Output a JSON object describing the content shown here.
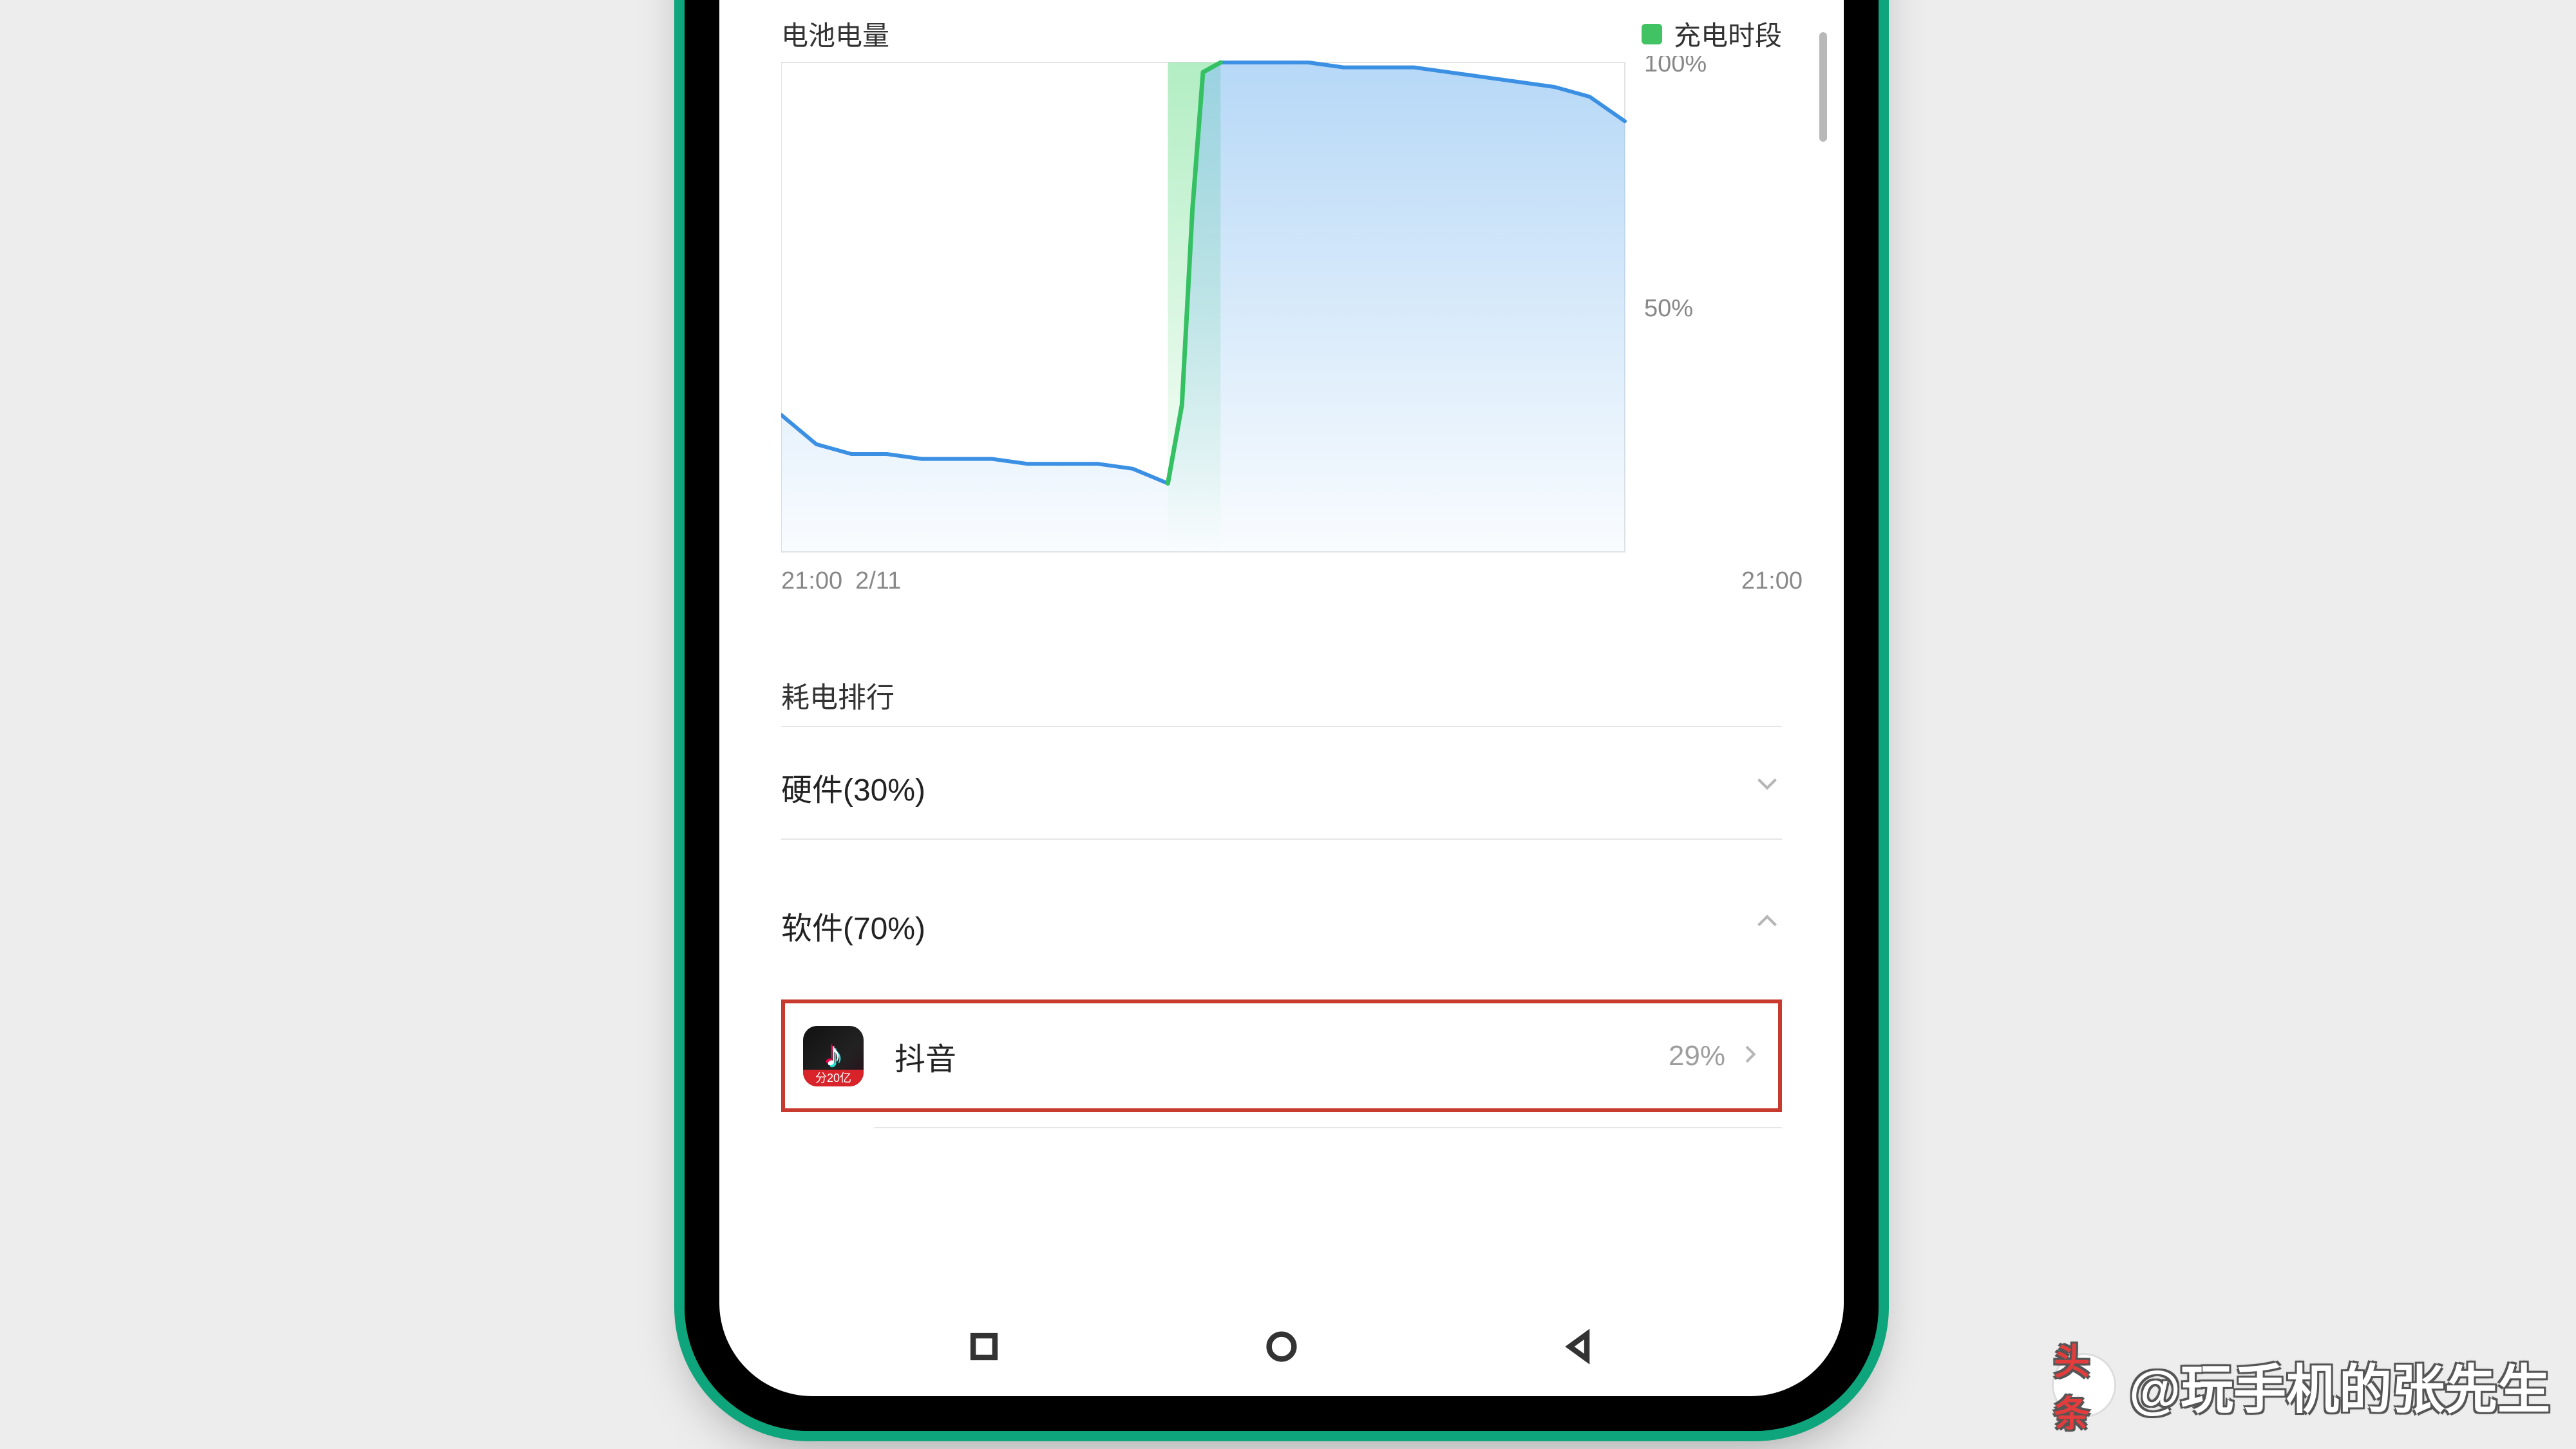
{
  "header": {
    "battery_label": "电池电量",
    "legend_label": "充电时段"
  },
  "chart_data": {
    "type": "area",
    "title": "",
    "xlabel": "",
    "ylabel": "",
    "ylim": [
      0,
      100
    ],
    "y_ticks": [
      "100%",
      "50%"
    ],
    "x_ticks_left": [
      "21:00",
      "2/11"
    ],
    "x_tick_right": "21:00",
    "x": [
      0,
      1,
      2,
      3,
      4,
      5,
      6,
      7,
      8,
      9,
      10,
      11,
      11.4,
      11.7,
      12,
      12.5,
      13,
      14,
      15,
      16,
      17,
      18,
      19,
      20,
      21,
      22,
      23,
      24
    ],
    "values": [
      28,
      22,
      20,
      20,
      19,
      19,
      19,
      18,
      18,
      18,
      17,
      14,
      30,
      70,
      98,
      100,
      100,
      100,
      100,
      99,
      99,
      99,
      98,
      97,
      96,
      95,
      93,
      88
    ],
    "charging_segment": {
      "start": 11,
      "end": 12.5
    }
  },
  "sections": {
    "ranking_title": "耗电排行",
    "hardware": {
      "label": "硬件(30%)",
      "expanded": false
    },
    "software": {
      "label": "软件(70%)",
      "expanded": true
    }
  },
  "apps": [
    {
      "name": "抖音",
      "percent": "29%",
      "icon_ribbon": "分20亿"
    }
  ],
  "watermark": {
    "logo_text": "头条",
    "text": "@玩手机的张先生"
  }
}
